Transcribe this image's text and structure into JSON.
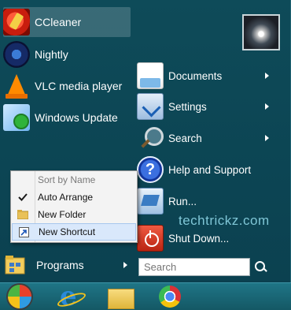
{
  "pinned": [
    {
      "label": "CCleaner",
      "icon": "ccleaner-icon",
      "selected": true
    },
    {
      "label": "Nightly",
      "icon": "nightly-icon"
    },
    {
      "label": "VLC media player",
      "icon": "vlc-icon"
    },
    {
      "label": "Windows Update",
      "icon": "windows-update-icon"
    }
  ],
  "context_menu": {
    "header": "Sort by Name",
    "items": [
      {
        "label": "Auto Arrange",
        "icon": "checkmark-icon"
      },
      {
        "label": "New Folder",
        "icon": "folder-icon"
      },
      {
        "label": "New Shortcut",
        "icon": "shortcut-icon",
        "highlighted": true
      }
    ]
  },
  "programs_label": "Programs",
  "right_items": [
    {
      "label": "Documents",
      "icon": "documents-icon",
      "submenu": true
    },
    {
      "label": "Settings",
      "icon": "settings-icon",
      "submenu": true
    },
    {
      "label": "Search",
      "icon": "search-icon",
      "submenu": true
    },
    {
      "label": "Help and Support",
      "icon": "help-icon"
    },
    {
      "label": "Run...",
      "icon": "run-icon"
    },
    {
      "label": "Shut Down...",
      "icon": "shutdown-icon"
    }
  ],
  "search": {
    "placeholder": "Search"
  },
  "watermark": "techtrickz.com",
  "taskbar": [
    "start-orb-icon",
    "internet-explorer-icon",
    "file-explorer-icon",
    "chrome-icon"
  ],
  "colors": {
    "menu_bg": "#0e4b59",
    "taskbar": "#1f7586",
    "watermark": "#7fc6d6"
  }
}
